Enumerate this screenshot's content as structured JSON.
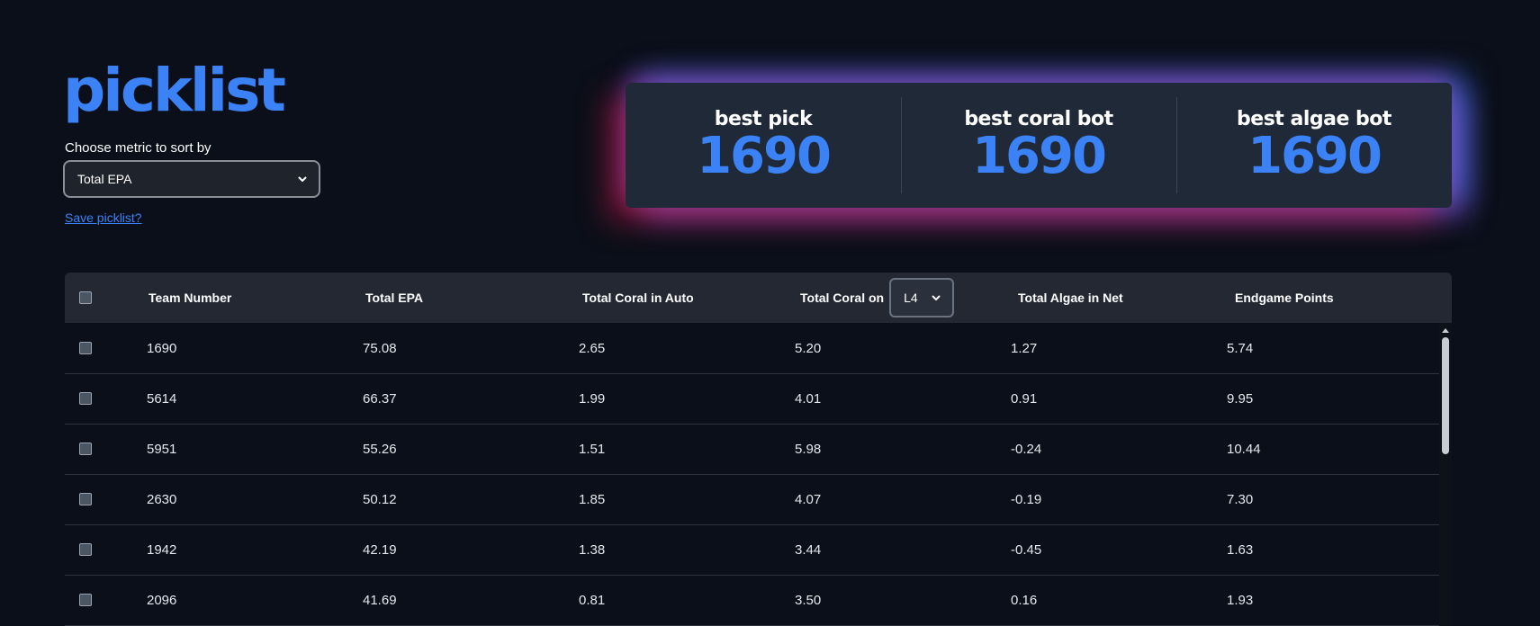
{
  "header": {
    "title": "picklist",
    "metric_label": "Choose metric to sort by",
    "metric_selected": "Total EPA",
    "save_link": "Save picklist?"
  },
  "best": [
    {
      "label": "best pick",
      "value": "1690"
    },
    {
      "label": "best coral bot",
      "value": "1690"
    },
    {
      "label": "best algae bot",
      "value": "1690"
    }
  ],
  "table": {
    "headers": {
      "team": "Team Number",
      "epa": "Total EPA",
      "coral_auto": "Total Coral in Auto",
      "coral_on": "Total Coral on",
      "coral_level": "L4",
      "algae_net": "Total Algae in Net",
      "endgame": "Endgame Points"
    },
    "rows": [
      [
        "1690",
        "75.08",
        "2.65",
        "5.20",
        "1.27",
        "5.74"
      ],
      [
        "5614",
        "66.37",
        "1.99",
        "4.01",
        "0.91",
        "9.95"
      ],
      [
        "5951",
        "55.26",
        "1.51",
        "5.98",
        "-0.24",
        "10.44"
      ],
      [
        "2630",
        "50.12",
        "1.85",
        "4.07",
        "-0.19",
        "7.30"
      ],
      [
        "1942",
        "42.19",
        "1.38",
        "3.44",
        "-0.45",
        "1.63"
      ],
      [
        "2096",
        "41.69",
        "0.81",
        "3.50",
        "0.16",
        "1.93"
      ]
    ]
  },
  "colors": {
    "background": "#0b0f19",
    "accent": "#3b82f6",
    "card": "#1f2937",
    "table_header": "#232833"
  }
}
